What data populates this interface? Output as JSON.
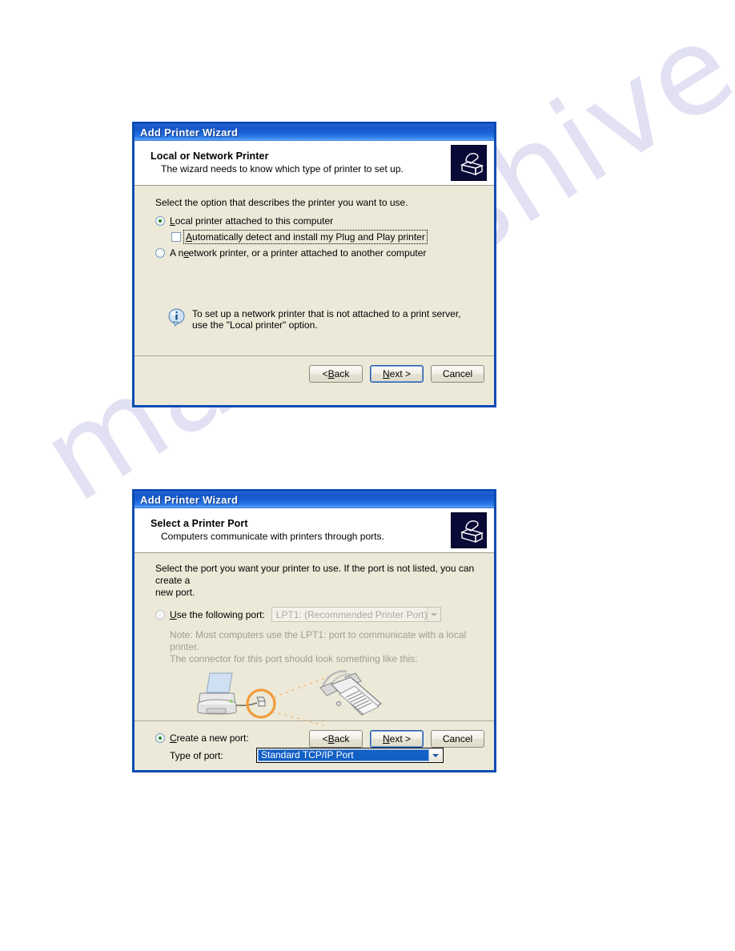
{
  "page": {
    "watermark": "manualshive.com",
    "background_color": "#ffffff"
  },
  "colors": {
    "titlebar_blue": "#1656c8",
    "dialog_border": "#0a4cb5",
    "panel_beige": "#ece9d8",
    "selection_blue": "#1260c4",
    "radio_dot_green": "#1f8a1f",
    "disabled_gray": "#9d9d93",
    "watermark_lavender": "#c9c9ea",
    "highlight_orange": "#f29c3c"
  },
  "dialog1": {
    "titlebar": {
      "title": "Add Printer Wizard",
      "icon": "printer-icon"
    },
    "header": {
      "title": "Local or Network Printer",
      "subtitle": "The wizard needs to know which type of printer to set up.",
      "icon": "printer-icon"
    },
    "body": {
      "prompt": "Select the option that describes the printer you want to use.",
      "options": [
        {
          "id": "local-printer",
          "type": "radio",
          "checked": true,
          "label_prefix": "L",
          "label_rest": "ocal printer attached to this computer"
        },
        {
          "id": "auto-detect",
          "type": "checkbox",
          "checked": false,
          "focused": true,
          "label_prefix": "A",
          "label_rest": "utomatically detect and install my Plug and Play printer"
        },
        {
          "id": "network-printer",
          "type": "radio",
          "checked": false,
          "label_prefix": "A n",
          "label_rest": "etwork printer, or a printer attached to another computer"
        }
      ],
      "note": {
        "icon": "info-icon",
        "line1": "To set up a network printer that is not attached to a print server,",
        "line2": "use the \"Local printer\" option."
      }
    },
    "footer": {
      "back": {
        "prefix": "< ",
        "key": "B",
        "rest": "ack"
      },
      "next": {
        "key": "N",
        "rest": "ext >",
        "is_default": true
      },
      "cancel": {
        "label": "Cancel"
      }
    }
  },
  "dialog2": {
    "titlebar": {
      "title": "Add Printer Wizard",
      "icon": "printer-icon"
    },
    "header": {
      "title": "Select a Printer Port",
      "subtitle": "Computers communicate with printers through ports.",
      "icon": "printer-icon"
    },
    "body": {
      "prompt_line1": "Select the port you want your printer to use.  If the port is not listed, you can create a",
      "prompt_line2": "new port.",
      "use_port": {
        "id": "use-following-port",
        "type": "radio",
        "checked": false,
        "disabled": true,
        "label_prefix": "U",
        "label_rest": "se the following port:",
        "combo_value": "LPT1: (Recommended Printer Port)",
        "combo_disabled": true
      },
      "note_line1": "Note: Most computers use the LPT1: port to communicate with a local printer.",
      "note_line2": "The connector for this port should look something like this:",
      "illustration": "printer-parallel-cable-connector-illustration",
      "create_port": {
        "id": "create-new-port",
        "type": "radio",
        "checked": true,
        "label_prefix": "C",
        "label_rest": "reate a new port:"
      },
      "type_of_port": {
        "label": "Type of port:",
        "value": "Standard TCP/IP Port",
        "selected": true
      }
    },
    "footer": {
      "back": {
        "prefix": "< ",
        "key": "B",
        "rest": "ack"
      },
      "next": {
        "key": "N",
        "rest": "ext >",
        "is_default": true
      },
      "cancel": {
        "label": "Cancel"
      }
    }
  }
}
